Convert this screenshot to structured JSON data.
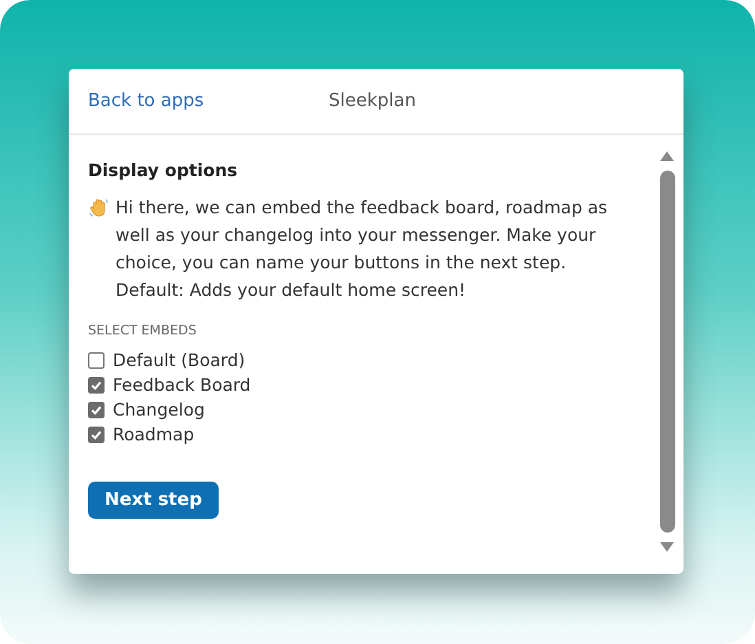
{
  "header": {
    "back_link": "Back to apps",
    "title": "Sleekplan"
  },
  "content": {
    "heading": "Display options",
    "intro": "Hi there, we can embed the feedback board, roadmap as well as your changelog into your messenger. Make your choice, you can name your buttons in the next step. Default: Adds your default home screen!",
    "section_label": "SELECT EMBEDS",
    "embeds": [
      {
        "label": "Default (Board)",
        "checked": false
      },
      {
        "label": "Feedback Board",
        "checked": true
      },
      {
        "label": "Changelog",
        "checked": true
      },
      {
        "label": "Roadmap",
        "checked": true
      }
    ],
    "button": "Next step"
  }
}
